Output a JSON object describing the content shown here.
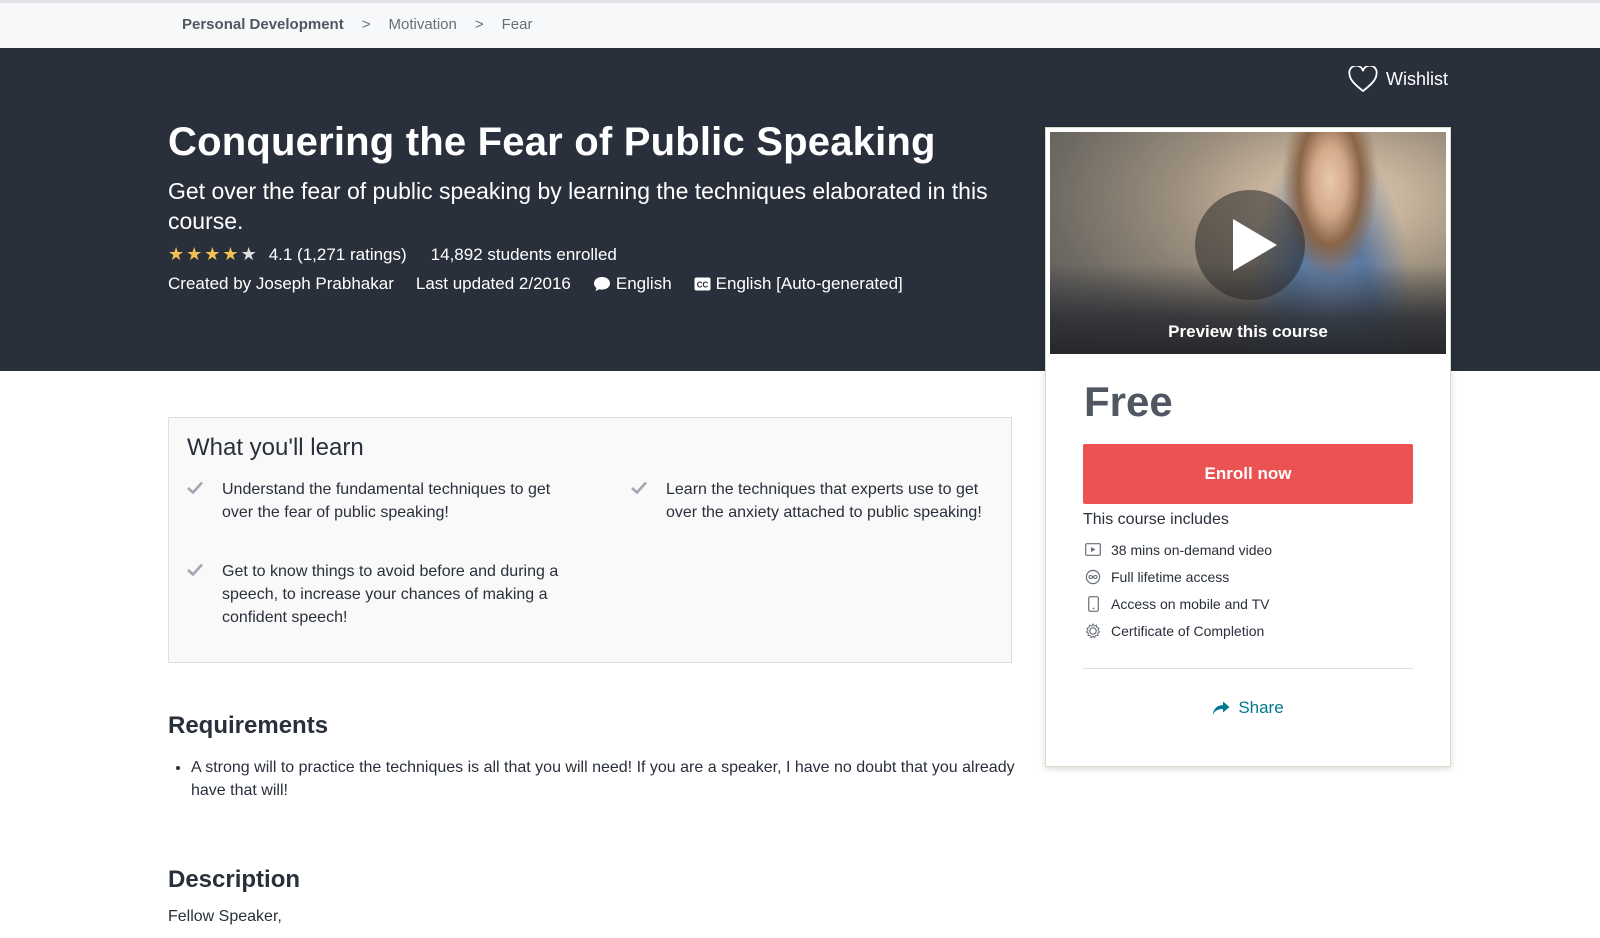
{
  "breadcrumb": {
    "items": [
      "Personal Development",
      "Motivation",
      "Fear"
    ],
    "separator": ">"
  },
  "header": {
    "wishlist_label": "Wishlist",
    "title": "Conquering the Fear of Public Speaking",
    "subtitle": "Get over the fear of public speaking by learning the techniques elaborated in this course.",
    "rating": {
      "stars": 4.1,
      "text": "4.1 (1,271 ratings)"
    },
    "enrolled": "14,892 students enrolled",
    "created_by": "Created by Joseph Prabhakar",
    "last_updated": "Last updated 2/2016",
    "language": "English",
    "captions": "English [Auto-generated]"
  },
  "sidebar": {
    "preview_label": "Preview this course",
    "price": "Free",
    "enroll_label": "Enroll now",
    "includes_title": "This course includes",
    "includes": [
      {
        "icon": "video-icon",
        "label": "38 mins on-demand video"
      },
      {
        "icon": "infinity-icon",
        "label": "Full lifetime access"
      },
      {
        "icon": "mobile-icon",
        "label": "Access on mobile and TV"
      },
      {
        "icon": "certificate-icon",
        "label": "Certificate of Completion"
      }
    ],
    "share_label": "Share"
  },
  "learn": {
    "title": "What you'll learn",
    "items": [
      "Understand the fundamental techniques to get over the fear of public speaking!",
      "Learn the techniques that experts use to get over the anxiety attached to public speaking!",
      "Get to know things to avoid before and during a speech, to increase your chances of making a confident speech!"
    ]
  },
  "requirements": {
    "title": "Requirements",
    "items": [
      "A strong will to practice the techniques is all that you will need! If you are a speaker, I have no doubt that you already have that will!"
    ]
  },
  "description": {
    "title": "Description",
    "first_line": "Fellow Speaker,"
  },
  "colors": {
    "hero_bg": "#29303b",
    "enroll_button": "#ec5252",
    "star": "#f4c150",
    "link": "#007791"
  }
}
